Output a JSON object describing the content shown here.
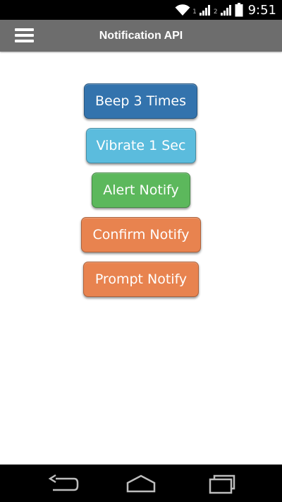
{
  "status_bar": {
    "sim1": "1",
    "sim2": "2",
    "time": "9:51"
  },
  "app_bar": {
    "title": "Notification API",
    "menu_icon": "hamburger-menu-icon"
  },
  "buttons": {
    "beep": "Beep 3 Times",
    "vibrate": "Vibrate 1 Sec",
    "alert": "Alert Notify",
    "confirm": "Confirm Notify",
    "prompt": "Prompt Notify"
  },
  "colors": {
    "app_bar": "#6d6d6d",
    "primary": "#3373ad",
    "info": "#5bbcdd",
    "success": "#5cb85c",
    "warning": "#e8834f"
  },
  "nav_bar": {
    "icons": [
      "back-icon",
      "home-icon",
      "recent-apps-icon"
    ]
  }
}
